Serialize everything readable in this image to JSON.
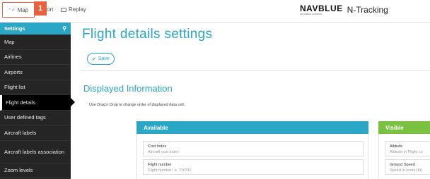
{
  "topbar": {
    "tabs": {
      "map": "Map",
      "report": "ort",
      "replay": "Replay"
    },
    "step_badge": "1",
    "brand": {
      "logo": "NAVBLUE",
      "logo_sub": "AN AIRBUS COMPANY",
      "product": "N-Tracking"
    }
  },
  "sidebar": {
    "header": "Settings",
    "items": [
      "Map",
      "Airlines",
      "Airports",
      "Flight list",
      "Flight details",
      "User defined tags",
      "Aircraft labels",
      "Aircraft labels association",
      "Zoom levels"
    ],
    "active_index": 4
  },
  "main": {
    "title": "Flight details settings",
    "save_label": "Save",
    "section_title": "Displayed Information",
    "hint": "Use Drag'n Drop to change order of displayed data cell.",
    "available": {
      "header": "Available",
      "items": [
        {
          "title": "Cost Index",
          "desc": "Aircraft cost index"
        },
        {
          "title": "Flight number",
          "desc": "Flight number i.e. 'DY311'"
        }
      ]
    },
    "visible": {
      "header": "Visible",
      "items": [
        {
          "title": "Altitude",
          "desc": "Altitude in Flight Le"
        },
        {
          "title": "Ground Speed",
          "desc": "Speed in knots (kt)"
        }
      ]
    }
  },
  "colors": {
    "accent": "#2aa7c7",
    "visible_green": "#7ac141",
    "badge": "#e8603c",
    "sidebar_bg": "#252525"
  }
}
